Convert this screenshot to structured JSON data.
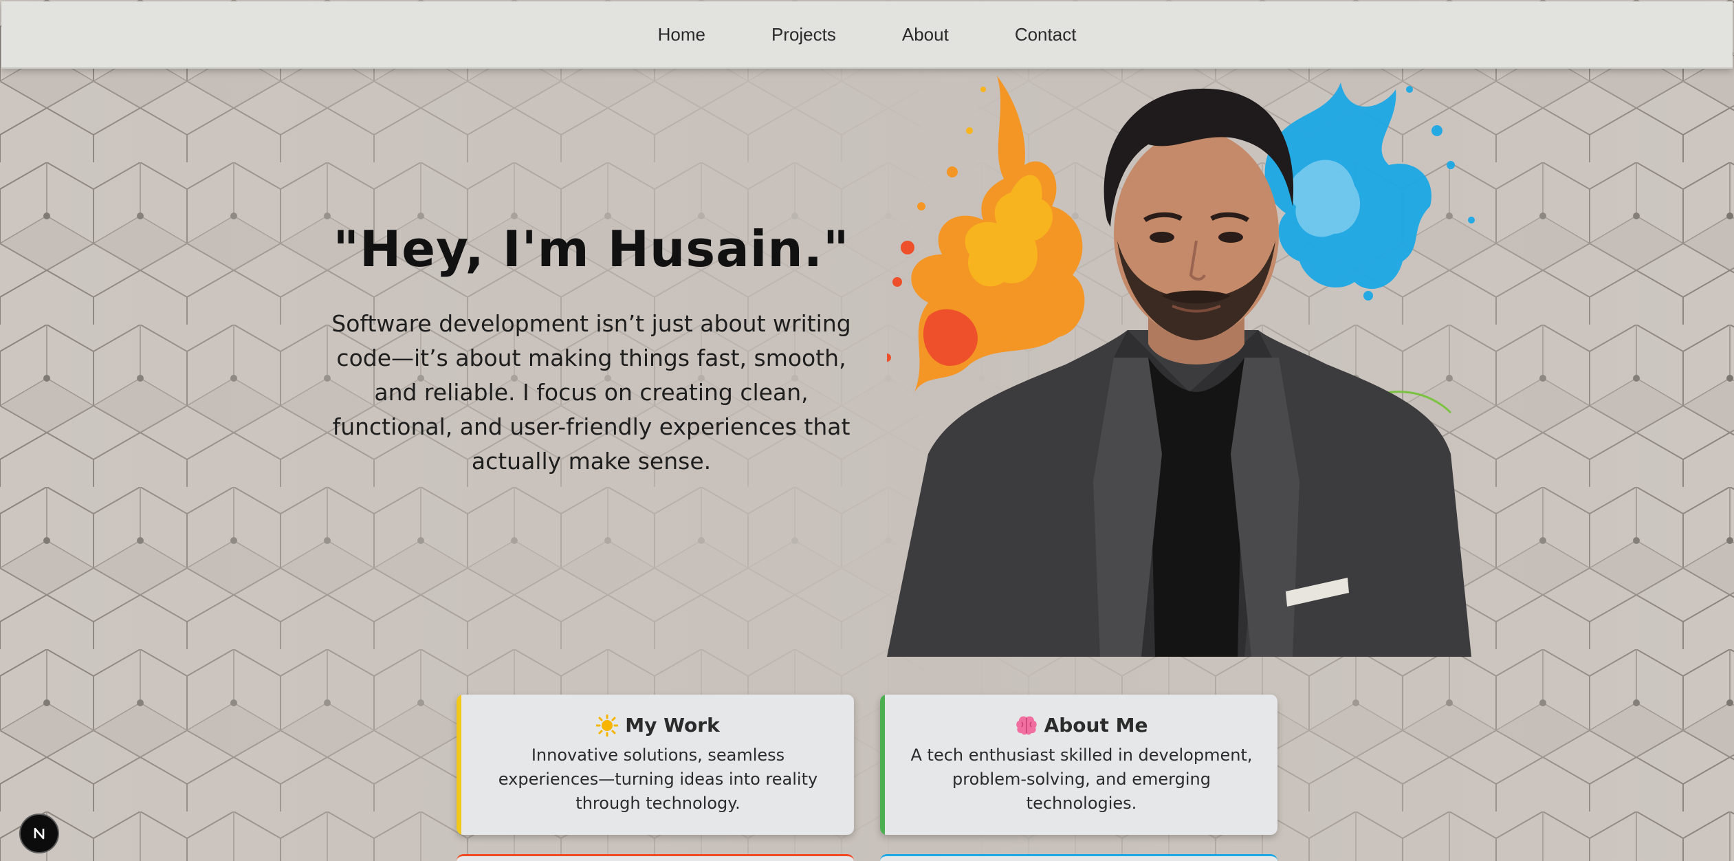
{
  "nav": {
    "items": [
      {
        "label": "Home"
      },
      {
        "label": "Projects"
      },
      {
        "label": "About"
      },
      {
        "label": "Contact"
      }
    ]
  },
  "hero": {
    "title": "\"Hey, I'm Husain.\"",
    "description": "Software development isn’t just about writing code—it’s about making things fast, smooth, and reliable. I focus on creating clean, functional, and user-friendly experiences that actually make sense."
  },
  "cards": [
    {
      "icon": "sun-icon",
      "title": "My Work",
      "description": "Innovative solutions, seamless experiences—turning ideas into reality through technology.",
      "accent": "#f2c81c"
    },
    {
      "icon": "brain-icon",
      "title": "About Me",
      "description": "A tech enthusiast skilled in development, problem-solving, and emerging technologies.",
      "accent": "#4caf50"
    }
  ],
  "next_badge": {
    "icon": "nextjs-icon",
    "letter": "N"
  },
  "colors": {
    "navbar_bg": "#e2e2de",
    "page_bg": "#c8c1bb",
    "card_bg": "#e5e7e8",
    "splash_orange": "#f7941d",
    "splash_blue": "#1da8e6"
  }
}
